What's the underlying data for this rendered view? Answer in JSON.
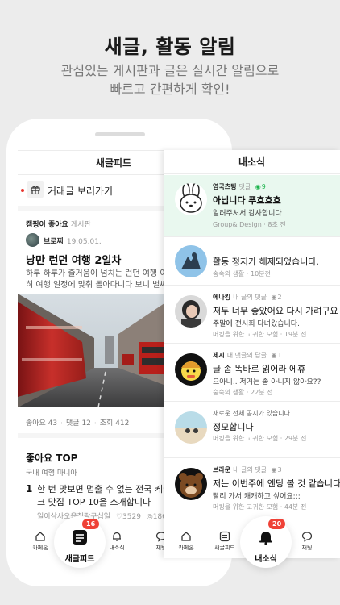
{
  "hero": {
    "title": "새글, 활동 알림",
    "subtitle_line1": "관심있는 게시판과 글은 실시간 알림으로",
    "subtitle_line2": "빠르고 간편하게 확인!"
  },
  "feed": {
    "header_title": "새글피드",
    "trade_link": "거래글 보러가기",
    "post": {
      "meta_author": "캠핑이 좋아요",
      "meta_board": "게시판",
      "author": "브로찌",
      "date": "19.05.01.",
      "title": "낭만 런던 여행 2일차",
      "excerpt_line1": "하루 하루가 즐거움이 넘치는 런던 여행 이틀 째",
      "excerpt_line2": "히 여행 일정에 맞춰 돌아다니다 보니 벌써 저녁",
      "likes": "좋아요 43",
      "comments": "댓글 12",
      "views": "조회 412"
    },
    "likes_top": {
      "title": "좋아요 TOP",
      "subtitle": "국내 여행 마니아",
      "rank": "1",
      "text_line1": "한 번 맛보면 멈출 수 없는 전국 케이",
      "text_line2": "크 맛집 TOP 10을 소개합니다",
      "meta_author": "일이삼사오육칠팔구십일",
      "meta_hearts": "3529",
      "meta_views": "1862"
    }
  },
  "notifications": {
    "header_title": "내소식",
    "items": [
      {
        "name": "영국츠팅",
        "type": "댓글",
        "count": "9",
        "line1": "아닙니다 푸흐흐흐",
        "line2": "알려주셔서 감사합니다",
        "source": "Group& Design",
        "time": "8초 전"
      },
      {
        "name": "",
        "type": "",
        "count": "",
        "line1": "활동 정지가 해제되었습니다.",
        "line2": "",
        "source": "숭숙의 생활",
        "time": "10분전"
      },
      {
        "name": "에나킹",
        "type": "내 글의 댓글",
        "count": "2",
        "line1": "저두 너무 좋았어요 다시 가려구요",
        "line2": "주말에 전시회 다녀왔습니다.",
        "source": "머킹을 위한 고귀한 모험",
        "time": "19분 전"
      },
      {
        "name": "제시",
        "type": "내 댓글의 답글",
        "count": "1",
        "line1": "글 좀 똑바로 읽어라 에휴",
        "line2": "으아니.. 저거는 좀 아니지 않아요??",
        "source": "숭숙의 생활",
        "time": "22분 전"
      },
      {
        "name": "",
        "type": "새로운 전체 공지가 있습니다.",
        "count": "",
        "line1": "정모합니다",
        "line2": "",
        "source": "머킹을 위한 고귀한 모험",
        "time": "29분 전"
      },
      {
        "name": "브라운",
        "type": "내 글의 댓글",
        "count": "3",
        "line1": "저는 이번주에 엔딩 볼 것 같습니다 하",
        "line2": "빨리 가서 캐캐하고 싶어요;;;",
        "source": "머킹을 위한 고귀한 모험",
        "time": "44분 전"
      }
    ]
  },
  "tabbar": {
    "home": "카페홈",
    "feed": "새글피드",
    "notif": "내소식",
    "chat": "채팅",
    "feed_badge": "16",
    "notif_badge": "20"
  },
  "colors": {
    "accent_red": "#ef4136",
    "accent_green": "#19b34a",
    "highlight_bg": "#e9f8ef"
  }
}
